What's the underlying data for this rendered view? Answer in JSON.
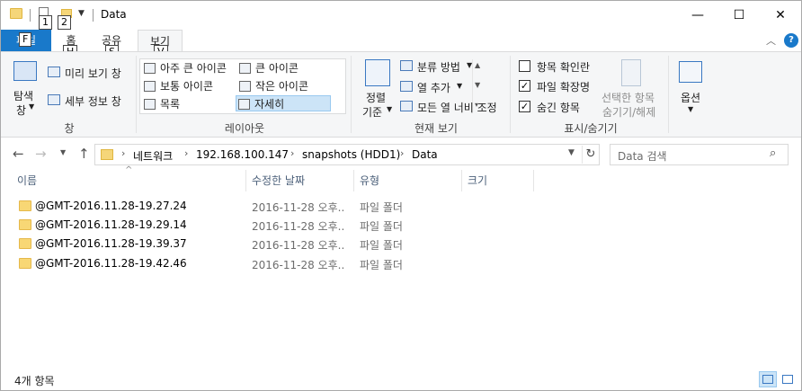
{
  "window": {
    "title": "Data",
    "keytips": {
      "qa_new": "1",
      "qa_folder": "2",
      "file": "F",
      "home": "H",
      "share": "S",
      "view": "V"
    },
    "controls": {
      "minimize": "—",
      "maximize": "☐",
      "close": "✕"
    }
  },
  "ribbon_tabs": {
    "file": "파일",
    "home": "홈",
    "share": "공유",
    "view": "보기",
    "help": "?"
  },
  "ribbon": {
    "pane": {
      "nav_pane_label_1": "탐색",
      "nav_pane_label_2": "창",
      "preview_pane": "미리 보기 창",
      "details_pane": "세부 정보 창",
      "group_label": "창"
    },
    "layout": {
      "items": [
        "아주 큰 아이콘",
        "큰 아이콘",
        "보통 아이콘",
        "작은 아이콘",
        "목록",
        "자세히"
      ],
      "selected": "자세히",
      "group_label": "레이아웃"
    },
    "current_view": {
      "sort_label_1": "정렬",
      "sort_label_2": "기준",
      "group_by": "분류 방법",
      "add_columns": "열 추가",
      "size_all_columns": "모든 열 너비 조정",
      "group_label": "현재 보기"
    },
    "show_hide": {
      "item_check_boxes": "항목 확인란",
      "item_check_boxes_checked": false,
      "file_name_extensions": "파일 확장명",
      "file_name_extensions_checked": true,
      "hidden_items": "숨긴 항목",
      "hidden_items_checked": true,
      "hide_selected_1": "선택한 항목",
      "hide_selected_2": "숨기기/해제",
      "group_label": "표시/숨기기"
    },
    "options": {
      "label": "옵션"
    }
  },
  "address": {
    "breadcrumbs": [
      "네트워크",
      "192.168.100.147",
      "snapshots (HDD1)",
      "Data"
    ],
    "search_placeholder": "Data 검색"
  },
  "columns": {
    "name": "이름",
    "date_modified": "수정한 날짜",
    "type": "유형",
    "size": "크기"
  },
  "files": [
    {
      "name": "@GMT-2016.11.28-19.27.24",
      "date": "2016-11-28 오후...",
      "type": "파일 폴더"
    },
    {
      "name": "@GMT-2016.11.28-19.29.14",
      "date": "2016-11-28 오후...",
      "type": "파일 폴더"
    },
    {
      "name": "@GMT-2016.11.28-19.39.37",
      "date": "2016-11-28 오후...",
      "type": "파일 폴더"
    },
    {
      "name": "@GMT-2016.11.28-19.42.46",
      "date": "2016-11-28 오후...",
      "type": "파일 폴더"
    }
  ],
  "status": {
    "item_count": "4개 항목"
  },
  "colors": {
    "accent": "#1979ca",
    "selection": "#cce4f7",
    "folder": "#f8d775"
  }
}
